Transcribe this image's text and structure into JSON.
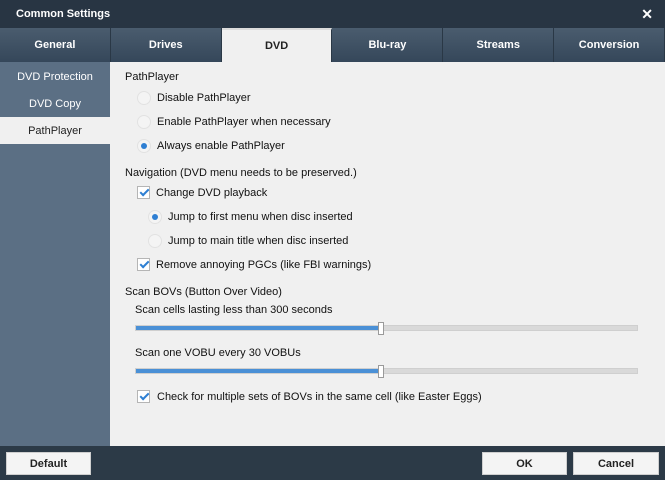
{
  "window": {
    "title": "Common Settings",
    "close": "✕"
  },
  "tabs": [
    "General",
    "Drives",
    "DVD",
    "Blu-ray",
    "Streams",
    "Conversion"
  ],
  "sidebar": {
    "items": [
      "DVD Protection",
      "DVD Copy",
      "PathPlayer"
    ]
  },
  "pathplayer": {
    "heading": "PathPlayer",
    "options": [
      "Disable PathPlayer",
      "Enable PathPlayer when necessary",
      "Always enable PathPlayer"
    ],
    "selected_index": 2
  },
  "navigation": {
    "heading": "Navigation (DVD menu needs to be preserved.)",
    "change_playback": "Change DVD playback",
    "change_playback_checked": true,
    "sub_options": [
      "Jump to first menu when disc inserted",
      "Jump to main title when disc inserted"
    ],
    "sub_selected_index": 0,
    "remove_pgcs": "Remove annoying PGCs (like FBI warnings)",
    "remove_pgcs_checked": true
  },
  "scan": {
    "heading": "Scan BOVs (Button Over Video)",
    "cells_label": "Scan cells lasting less than 300 seconds",
    "cells_fraction": 0.49,
    "vobu_label": "Scan one VOBU every 30 VOBUs",
    "vobu_fraction": 0.49,
    "multiple_sets": "Check for multiple sets of BOVs in the same cell (like Easter Eggs)",
    "multiple_sets_checked": true
  },
  "footer": {
    "default": "Default",
    "ok": "OK",
    "cancel": "Cancel"
  },
  "colors": {
    "accent": "#2e7fd3",
    "slider_fill": "#4a90d6",
    "titlebar": "#283543",
    "sidebar": "#5b6f84"
  }
}
